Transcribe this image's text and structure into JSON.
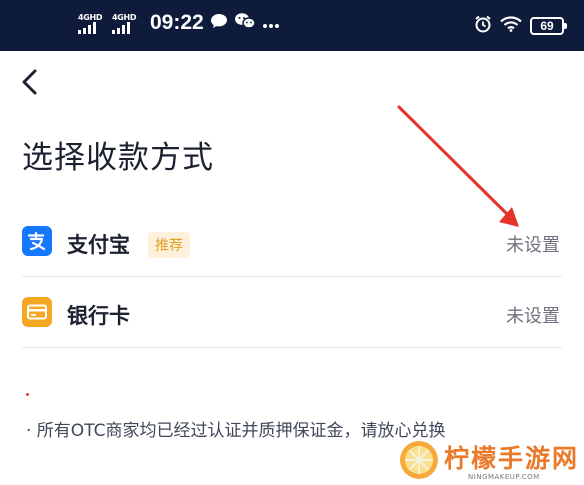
{
  "status_bar": {
    "signal_1": "4GHD",
    "signal_2": "4GHD",
    "time": "09:22",
    "battery": "69"
  },
  "page": {
    "title": "选择收款方式"
  },
  "methods": [
    {
      "label": "支付宝",
      "badge": "推荐",
      "status": "未设置",
      "icon": "alipay-icon",
      "color": "#1677ff"
    },
    {
      "label": "银行卡",
      "status": "未设置",
      "icon": "bank-card-icon",
      "color": "#f5a623"
    }
  ],
  "note": "· 所有OTC商家均已经过认证并质押保证金，请放心兑换",
  "watermark": {
    "text": "柠檬手游网",
    "sub": "NINGMAKEUP.COM"
  },
  "annotation": {
    "color": "#e5332a"
  }
}
